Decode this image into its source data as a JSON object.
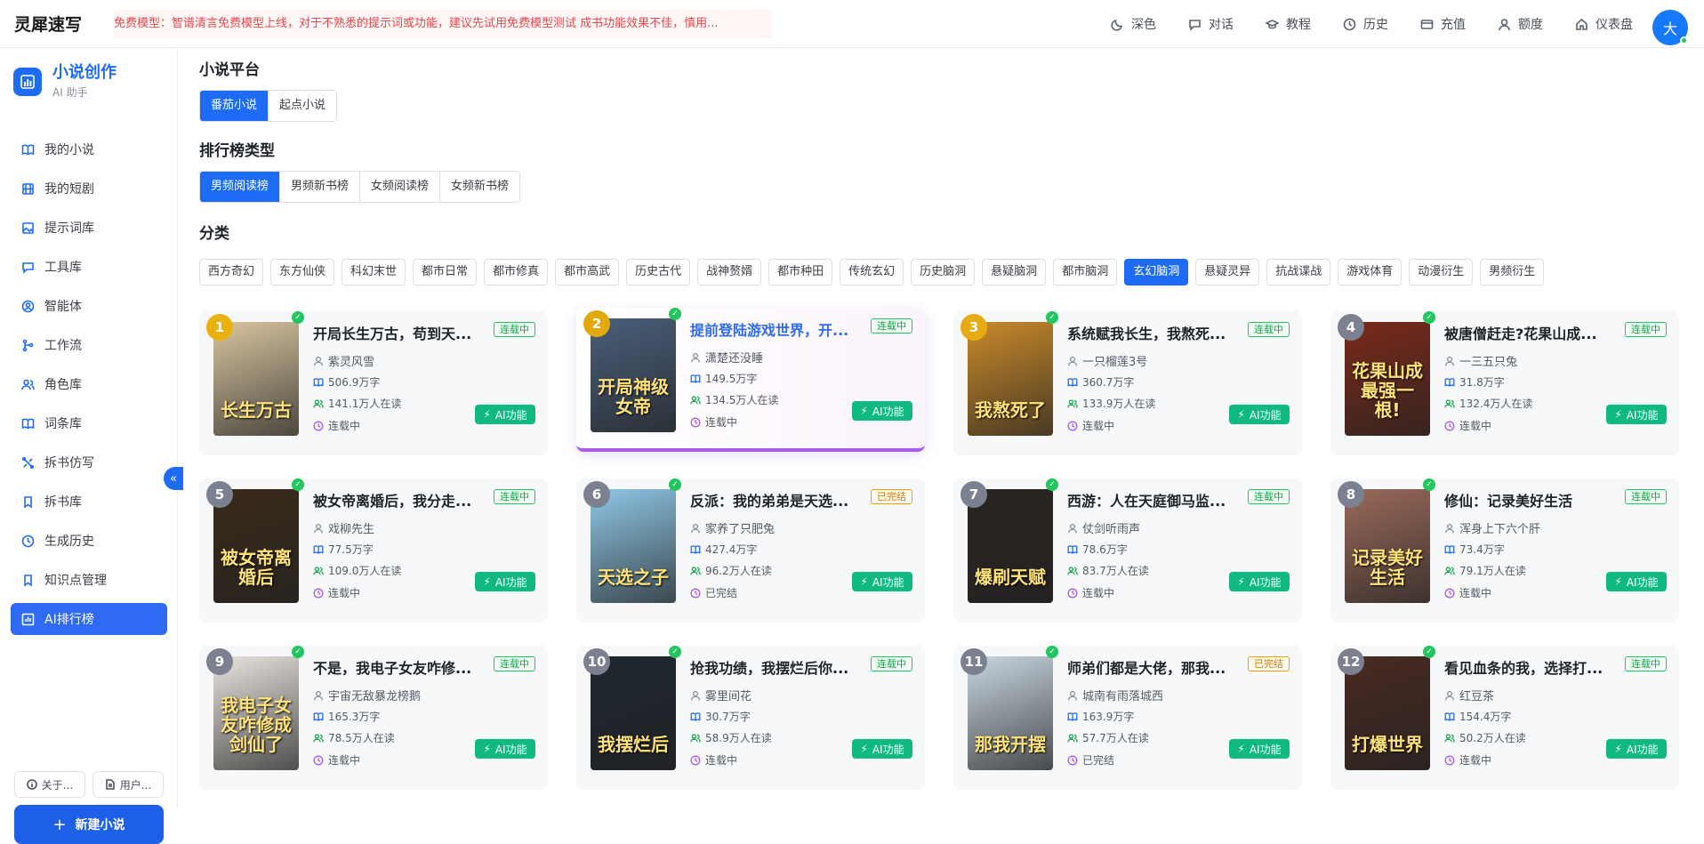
{
  "app": {
    "logo": "灵犀速写",
    "notice": "免费模型：智谱清言免费模型上线，对于不熟悉的提示词或功能，建议先试用免费模型测试 成书功能效果不佳，慎用...",
    "avatar": "大"
  },
  "topnav": [
    {
      "label": "深色",
      "icon": "moon-icon"
    },
    {
      "label": "对话",
      "icon": "chat-icon"
    },
    {
      "label": "教程",
      "icon": "graduation-cap-icon"
    },
    {
      "label": "历史",
      "icon": "clock-icon"
    },
    {
      "label": "充值",
      "icon": "card-icon"
    },
    {
      "label": "额度",
      "icon": "user-icon"
    },
    {
      "label": "仪表盘",
      "icon": "home-icon"
    }
  ],
  "sidebar": {
    "title": "小说创作",
    "subtitle": "AI 助手",
    "items": [
      {
        "label": "我的小说",
        "icon": "book-icon"
      },
      {
        "label": "我的短剧",
        "icon": "film-icon"
      },
      {
        "label": "提示词库",
        "icon": "image-icon"
      },
      {
        "label": "工具库",
        "icon": "chat-icon"
      },
      {
        "label": "智能体",
        "icon": "agent-icon"
      },
      {
        "label": "工作流",
        "icon": "flow-icon"
      },
      {
        "label": "角色库",
        "icon": "users-icon"
      },
      {
        "label": "词条库",
        "icon": "book-icon"
      },
      {
        "label": "拆书仿写",
        "icon": "split-icon"
      },
      {
        "label": "拆书库",
        "icon": "bookmark-icon"
      },
      {
        "label": "生成历史",
        "icon": "clock-icon"
      },
      {
        "label": "知识点管理",
        "icon": "bookmark-icon"
      },
      {
        "label": "AI排行榜",
        "icon": "chart-icon",
        "active": true
      }
    ],
    "about": "关于...",
    "user": "用户...",
    "new_novel": "新建小说"
  },
  "platform": {
    "heading": "小说平台",
    "tabs": [
      "番茄小说",
      "起点小说"
    ],
    "selected": "番茄小说"
  },
  "ranking": {
    "heading": "排行榜类型",
    "tabs": [
      "男频阅读榜",
      "男频新书榜",
      "女频阅读榜",
      "女频新书榜"
    ],
    "selected": "男频阅读榜"
  },
  "category": {
    "heading": "分类",
    "items": [
      "西方奇幻",
      "东方仙侠",
      "科幻末世",
      "都市日常",
      "都市修真",
      "都市高武",
      "历史古代",
      "战神赘婿",
      "都市种田",
      "传统玄幻",
      "历史脑洞",
      "悬疑脑洞",
      "都市脑洞",
      "玄幻脑洞",
      "悬疑灵异",
      "抗战谍战",
      "游戏体育",
      "动漫衍生",
      "男频衍生"
    ],
    "selected": "玄幻脑洞"
  },
  "books": [
    {
      "rank": "1",
      "title": "开局长生万古，苟到天...",
      "author": "紫灵风雪",
      "words": "506.9万字",
      "readers": "141.1万人在读",
      "status": "连载中",
      "badge": "连载中",
      "cover_text": "长生万古",
      "cover_color": "#d9c6a0"
    },
    {
      "rank": "2",
      "title": "提前登陆游戏世界，开...",
      "author": "潇楚还没睡",
      "words": "149.5万字",
      "readers": "134.5万人在读",
      "status": "连载中",
      "badge": "连载中",
      "cover_text": "开局神级女帝",
      "cover_color": "#4a5f7a"
    },
    {
      "rank": "3",
      "title": "系统赋我长生，我熬死...",
      "author": "一只榴莲3号",
      "words": "360.7万字",
      "readers": "133.9万人在读",
      "status": "连载中",
      "badge": "连载中",
      "cover_text": "我熬死了",
      "cover_color": "#c98a2a"
    },
    {
      "rank": "4",
      "title": "被唐僧赶走?花果山成...",
      "author": "一三五只兔",
      "words": "31.8万字",
      "readers": "132.4万人在读",
      "status": "连载中",
      "badge": "连载中",
      "cover_text": "花果山成最强一根!",
      "cover_color": "#7a2a1a"
    },
    {
      "rank": "5",
      "title": "被女帝离婚后，我分走...",
      "author": "戏柳先生",
      "words": "77.5万字",
      "readers": "109.0万人在读",
      "status": "连载中",
      "badge": "连载中",
      "cover_text": "被女帝离婚后",
      "cover_color": "#3a2a1a"
    },
    {
      "rank": "6",
      "title": "反派：我的弟弟是天选...",
      "author": "家养了只肥兔",
      "words": "427.4万字",
      "readers": "96.2万人在读",
      "status": "已完结",
      "badge": "已完结",
      "cover_text": "天选之子",
      "cover_color": "#8fc7e6"
    },
    {
      "rank": "7",
      "title": "西游：人在天庭御马监...",
      "author": "仗剑听雨声",
      "words": "78.6万字",
      "readers": "83.7万人在读",
      "status": "连载中",
      "badge": "连载中",
      "cover_text": "爆刷天赋",
      "cover_color": "#2a2420"
    },
    {
      "rank": "8",
      "title": "修仙：记录美好生活",
      "author": "浑身上下六个肝",
      "words": "73.4万字",
      "readers": "79.1万人在读",
      "status": "连载中",
      "badge": "连载中",
      "cover_text": "记录美好生活",
      "cover_color": "#9a6a5a"
    },
    {
      "rank": "9",
      "title": "不是，我电子女友咋修...",
      "author": "宇宙无敌暴龙榜鹅",
      "words": "165.3万字",
      "readers": "78.5万人在读",
      "status": "连载中",
      "badge": "连载中",
      "cover_text": "我电子女友咋修成剑仙了",
      "cover_color": "#e8e4de"
    },
    {
      "rank": "10",
      "title": "抢我功绩，我摆烂后你...",
      "author": "雾里间花",
      "words": "30.7万字",
      "readers": "58.9万人在读",
      "status": "连载中",
      "badge": "连载中",
      "cover_text": "我摆烂后",
      "cover_color": "#1e2630"
    },
    {
      "rank": "11",
      "title": "师弟们都是大佬，那我...",
      "author": "城南有雨落城西",
      "words": "163.9万字",
      "readers": "57.7万人在读",
      "status": "已完结",
      "badge": "已完结",
      "cover_text": "那我开摆",
      "cover_color": "#c9d6e0"
    },
    {
      "rank": "12",
      "title": "看见血条的我，选择打...",
      "author": "红豆茶",
      "words": "154.4万字",
      "readers": "50.2万人在读",
      "status": "连载中",
      "badge": "连载中",
      "cover_text": "打爆世界",
      "cover_color": "#4a2a22"
    }
  ],
  "ai_label": "AI功能",
  "colors": {
    "accent": "#1e6cf5",
    "serial": "#16a34a",
    "done": "#d97706",
    "ai": "#10b981",
    "gold": "#eab308",
    "gray": "#6b7280"
  }
}
